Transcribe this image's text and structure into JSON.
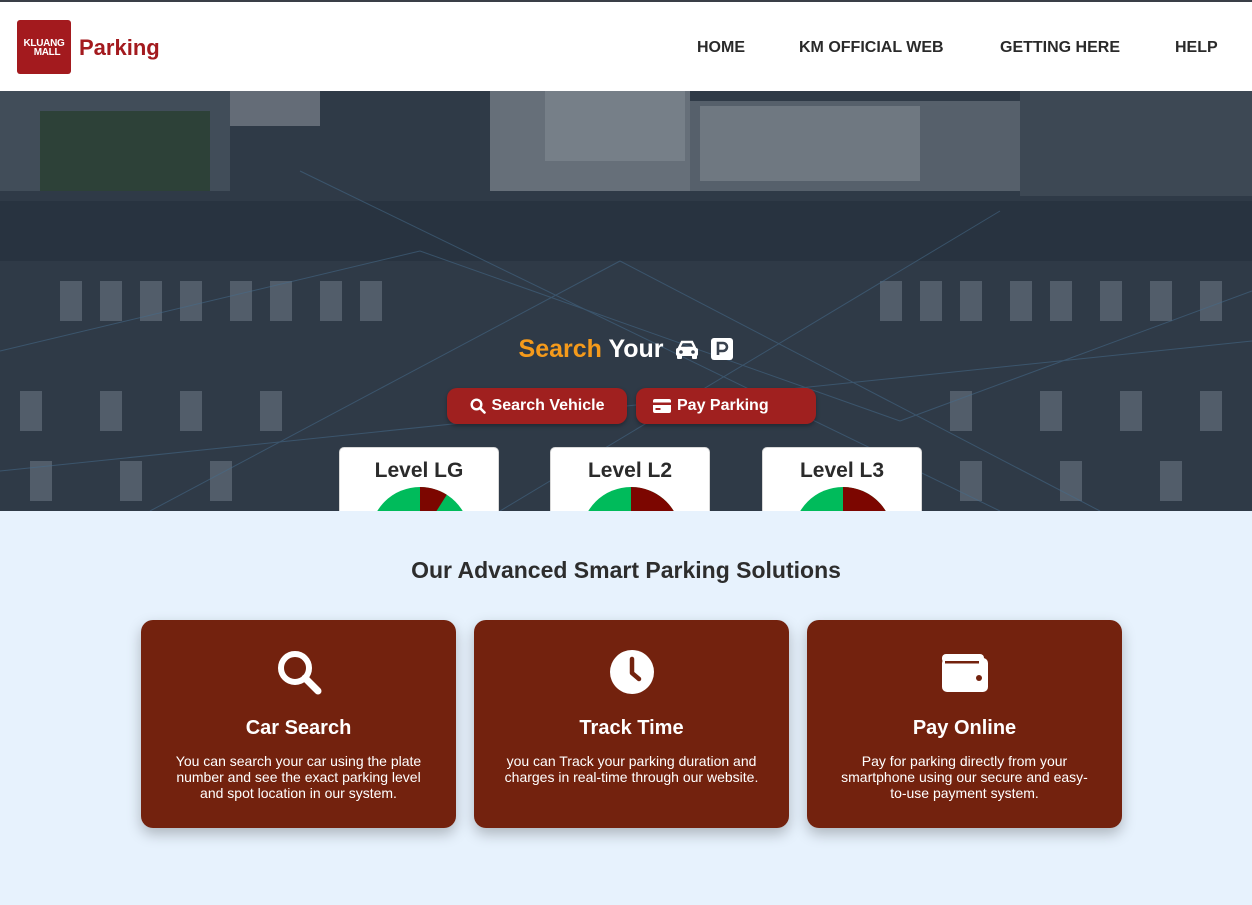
{
  "brand": {
    "logo_line1": "KLUANG",
    "logo_line2": "MALL",
    "name": "Parking"
  },
  "nav": {
    "items": [
      "HOME",
      "KM OFFICIAL WEB",
      "GETTING HERE",
      "HELP"
    ]
  },
  "hero": {
    "title_accent": "Search",
    "title_rest": "Your",
    "title_icons": [
      "car-icon",
      "parking-icon"
    ],
    "buttons": [
      {
        "label": "Search Vehicle",
        "icon": "search-icon"
      },
      {
        "label": "Pay Parking",
        "icon": "credit-card-icon"
      }
    ]
  },
  "levels": [
    {
      "label": "Level LG",
      "occupied_fraction": 0.09
    },
    {
      "label": "Level L2",
      "occupied_fraction": 0.68
    },
    {
      "label": "Level L3",
      "occupied_fraction": 0.81
    }
  ],
  "colors": {
    "available": "#00bb5b",
    "occupied": "#7c0600",
    "accent": "#f59a1b",
    "brand": "#a31a1e",
    "card": "#73220e"
  },
  "solutions": {
    "title": "Our Advanced Smart Parking Solutions",
    "cards": [
      {
        "title": "Car Search",
        "icon": "search-icon",
        "desc": "You can search your car using the plate number and see the exact parking level and spot location in our system."
      },
      {
        "title": "Track Time",
        "icon": "clock-icon",
        "desc": "you can Track your parking duration and charges in real-time through our website."
      },
      {
        "title": "Pay Online",
        "icon": "wallet-icon",
        "desc": "Pay for parking directly from your smartphone using our secure and easy-to-use payment system."
      }
    ]
  }
}
